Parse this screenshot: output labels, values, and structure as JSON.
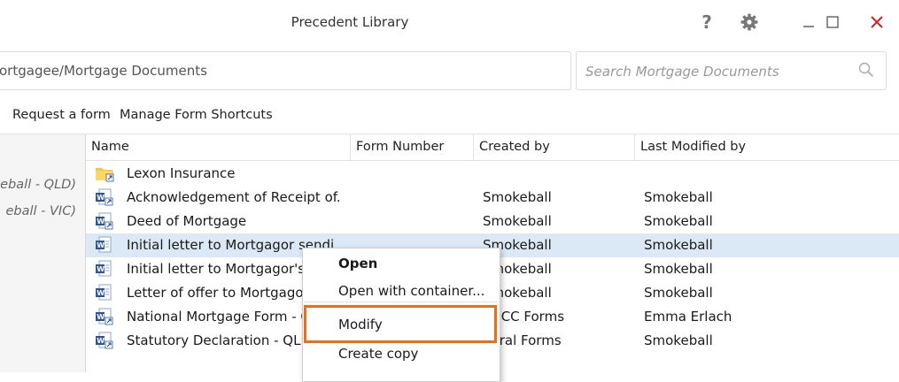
{
  "window": {
    "title": "Precedent Library",
    "controls": {
      "help": "?"
    }
  },
  "breadcrumb": {
    "text": "ortgagee/Mortgage Documents"
  },
  "search": {
    "placeholder": "Search Mortgage Documents"
  },
  "toolbar": {
    "request_form": "Request a form",
    "manage_shortcuts": "Manage Form Shortcuts"
  },
  "left_panel": {
    "items": [
      "eball - QLD)",
      "eball - VIC)"
    ]
  },
  "columns": [
    "Name",
    "Form Number",
    "Created by",
    "Last Modified by"
  ],
  "rows": [
    {
      "icon": "folder-icon",
      "name": "Lexon Insurance",
      "created_by": "",
      "modified_by": ""
    },
    {
      "icon": "word-shortcut-icon",
      "name": "Acknowledgement of Receipt of...",
      "created_by": "Smokeball",
      "modified_by": "Smokeball"
    },
    {
      "icon": "word-shortcut-icon",
      "name": "Deed of Mortgage",
      "created_by": "Smokeball",
      "modified_by": "Smokeball"
    },
    {
      "icon": "word-icon",
      "name": "Initial letter to Mortgagor sendi",
      "created_by": "Smokeball",
      "modified_by": "Smokeball",
      "selected": true
    },
    {
      "icon": "word-icon",
      "name": "Initial letter to Mortgagor's",
      "created_by": "Smokeball",
      "modified_by": "Smokeball"
    },
    {
      "icon": "word-icon",
      "name": "Letter of offer to Mortgagor",
      "created_by": "Smokeball",
      "modified_by": "Smokeball"
    },
    {
      "icon": "word-shortcut-icon",
      "name": "National Mortgage Form - C",
      "created_by": "NECC Forms",
      "modified_by": "Emma Erlach"
    },
    {
      "icon": "word-shortcut-icon",
      "name": "Statutory Declaration - QLD",
      "created_by": "neral Forms",
      "modified_by": "Smokeball"
    }
  ],
  "context_menu": {
    "items": [
      "Open",
      "Open with container...",
      "Modify",
      "Create copy"
    ],
    "highlighted": "Modify"
  },
  "colors": {
    "accent": "#e8701a",
    "selection": "#dbe8f5",
    "close": "#c42b1c",
    "word_blue": "#2b579a"
  }
}
